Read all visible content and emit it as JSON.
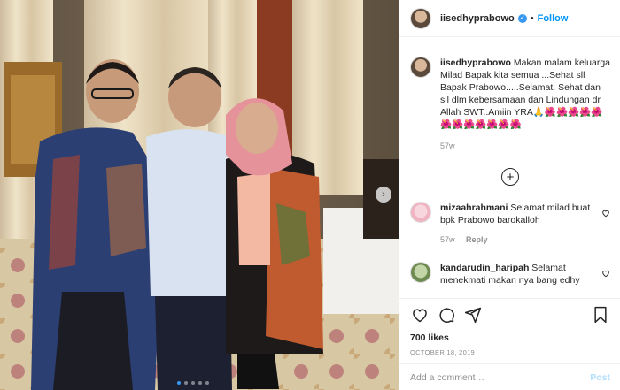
{
  "post": {
    "image_alt": "Group photo",
    "carousel": {
      "total": 5,
      "active": 0
    }
  },
  "header": {
    "username": "iisedhyprabowo",
    "follow_label": "Follow",
    "separator": "•"
  },
  "caption": {
    "username": "iisedhyprabowo",
    "text": "Makan malam keluarga Milad Bapak kita semua ...Sehat sll Bapak Prabowo.....Selamat. Sehat dan sll dlm kebersamaan dan Lindungan dr Allah SWT..Amiin YRA🙏🌺🌺🌺🌺🌺🌺🌺🌺🌺🌺🌺🌺",
    "time": "57w"
  },
  "comments": [
    {
      "username": "mizaahrahmani",
      "text": "Selamat milad buat bpk Prabowo barokalloh",
      "time": "57w",
      "reply_label": "Reply"
    },
    {
      "username": "kandarudin_haripah",
      "text": "Selamat menekmati makan nya bang edhy",
      "time": "",
      "reply_label": ""
    }
  ],
  "actions": {
    "likes": "700 likes",
    "date": "OCTOBER 18, 2019"
  },
  "comment_box": {
    "placeholder": "Add a comment…",
    "post_label": "Post"
  },
  "colors": {
    "link": "#0095f6",
    "muted": "#8e8e8e",
    "text": "#262626",
    "disabled_post": "#b2dffc"
  }
}
